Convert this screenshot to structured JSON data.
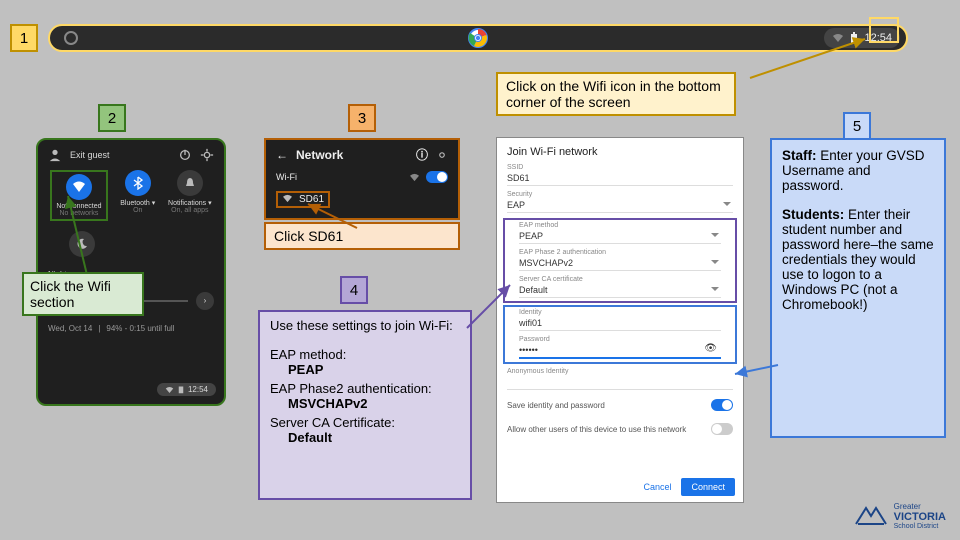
{
  "steps": {
    "s1": "1",
    "s2": "2",
    "s3": "3",
    "s4": "4",
    "s5": "5"
  },
  "shelf": {
    "time": "12:54"
  },
  "callouts": {
    "yellow": "Click on the Wifi icon in the bottom corner of the screen",
    "green": "Click the Wifi section",
    "orange": "Click SD61",
    "purple_intro": "Use these settings to join Wi-Fi:",
    "purple_eap_lbl": "EAP method:",
    "purple_eap_val": "PEAP",
    "purple_p2_lbl": "EAP Phase2 authentication:",
    "purple_p2_val": "MSVCHAPv2",
    "purple_ca_lbl": "Server CA Certificate:",
    "purple_ca_val": "Default",
    "blue_staff_lbl": "Staff:",
    "blue_staff_txt": " Enter your GVSD Username and password.",
    "blue_students_lbl": "Students:",
    "blue_students_txt": " Enter their student number and password here–the same credentials they would use to logon to a Windows PC (not a Chromebook!)"
  },
  "quick": {
    "exit": "Exit guest",
    "wifi_title": "Not connected",
    "wifi_sub": "No networks",
    "bt_title": "Bluetooth",
    "bt_sub": "On",
    "notif_title": "Notifications",
    "notif_sub": "On, all apps",
    "night": "Night",
    "date": "Wed, Oct 14",
    "batt": "94% - 0:15 until full",
    "time": "12:54"
  },
  "net": {
    "title": "Network",
    "wifi": "Wi-Fi",
    "ssid": "SD61"
  },
  "dialog": {
    "title": "Join Wi-Fi network",
    "ssid_lbl": "SSID",
    "ssid_val": "SD61",
    "sec_lbl": "Security",
    "sec_val": "EAP",
    "eap_lbl": "EAP method",
    "eap_val": "PEAP",
    "p2_lbl": "EAP Phase 2 authentication",
    "p2_val": "MSVCHAPv2",
    "ca_lbl": "Server CA certificate",
    "ca_val": "Default",
    "id_lbl": "Identity",
    "id_val": "wifi01",
    "pw_lbl": "Password",
    "pw_val": "••••••",
    "anon_lbl": "Anonymous Identity",
    "save": "Save identity and password",
    "allow": "Allow other users of this device to use this network",
    "cancel": "Cancel",
    "connect": "Connect"
  },
  "logo": {
    "l1": "Greater",
    "l2": "VICTORIA",
    "l3": "School District"
  }
}
